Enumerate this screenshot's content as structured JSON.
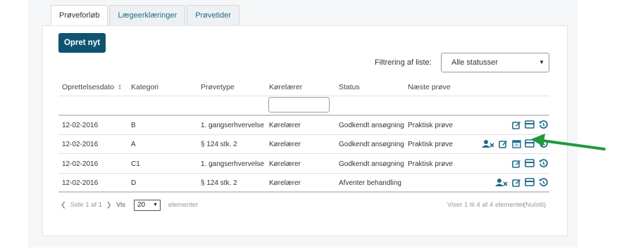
{
  "tabs": [
    {
      "label": "Prøveforløb",
      "active": true
    },
    {
      "label": "Lægeerklæringer",
      "active": false
    },
    {
      "label": "Prøvetider",
      "active": false
    }
  ],
  "create_button": "Opret nyt",
  "filter": {
    "label": "Filtrering af liste:",
    "selected": "Alle statusser"
  },
  "columns": [
    "Oprettelsesdato",
    "Kategori",
    "Prøvetype",
    "Kørelærer",
    "Status",
    "Næste prøve"
  ],
  "rows": [
    {
      "date": "12-02-2016",
      "category": "B",
      "test_type": "1. gangserhvervelse",
      "instructor": "Kørelærer",
      "status": "Godkendt ansøgning",
      "next_test": "Praktisk prøve",
      "actions": [
        "edit-icon",
        "card-icon",
        "history-icon"
      ]
    },
    {
      "date": "12-02-2016",
      "category": "A",
      "test_type": "§ 124 stk. 2",
      "instructor": "Kørelærer",
      "status": "Godkendt ansøgning",
      "next_test": "Praktisk prøve",
      "actions": [
        "remove-user-icon",
        "edit-icon",
        "calendar-icon",
        "card-icon",
        "history-icon"
      ]
    },
    {
      "date": "12-02-2016",
      "category": "C1",
      "test_type": "1. gangserhvervelse",
      "instructor": "Kørelærer",
      "status": "Godkendt ansøgning",
      "next_test": "Praktisk prøve",
      "actions": [
        "edit-icon",
        "card-icon",
        "history-icon"
      ]
    },
    {
      "date": "12-02-2016",
      "category": "D",
      "test_type": "§ 124 stk. 2",
      "instructor": "Kørelærer",
      "status": "Afventer behandling",
      "next_test": "",
      "actions": [
        "remove-user-icon",
        "edit-icon",
        "card-icon",
        "history-icon"
      ]
    }
  ],
  "pagination": {
    "page_text": "Side 1 af 1",
    "show_label": "Vis",
    "page_size": "20",
    "elements_label": "elementer",
    "summary": "Viser 1 til 4 af 4 elementer",
    "reset": "(Nulstil)"
  },
  "colors": {
    "primary": "#0e5470",
    "icon": "#1f6b8a",
    "arrow": "#1f9a3e"
  }
}
